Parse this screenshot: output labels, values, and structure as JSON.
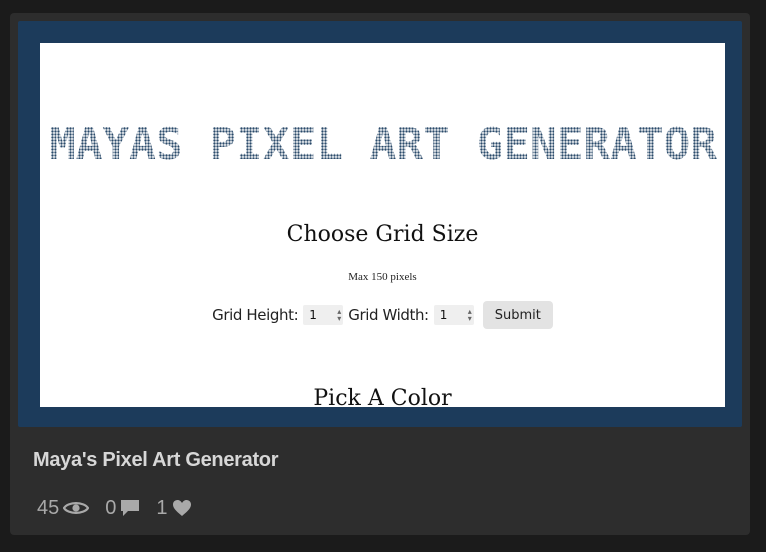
{
  "preview": {
    "banner_text": "MAYAS PIXEL ART GENERATOR",
    "choose_title": "Choose Grid Size",
    "max_note": "Max 150 pixels",
    "grid_height_label": "Grid Height:",
    "grid_height_value": "1",
    "grid_width_label": "Grid Width:",
    "grid_width_value": "1",
    "submit_label": "Submit",
    "pick_title": "Pick A Color"
  },
  "card": {
    "title": "Maya's Pixel Art Generator",
    "views": "45",
    "comments": "0",
    "likes": "1"
  },
  "colors": {
    "frame": "#1c3b5b",
    "banner": "#2a4a6a",
    "card_bg": "#2d2d2d"
  },
  "icons": [
    "eye-icon",
    "comment-icon",
    "heart-icon"
  ]
}
